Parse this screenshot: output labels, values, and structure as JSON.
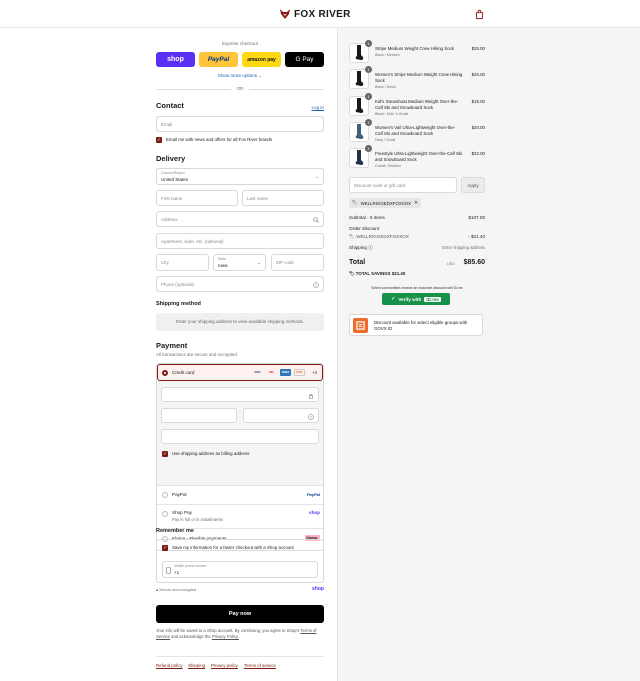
{
  "header": {
    "brand": "FOX RIVER"
  },
  "express": {
    "label": "Express checkout",
    "shop": "shop",
    "paypal": "PayPal",
    "amazon": "amazon pay",
    "gpay": "G Pay",
    "show_more": "Show more options ⌄",
    "or": "OR"
  },
  "contact": {
    "heading": "Contact",
    "login": "Log in",
    "email_placeholder": "Email",
    "news_label": "Email me with news and offers for all Fox River brands"
  },
  "delivery": {
    "heading": "Delivery",
    "country_label": "Country/Region",
    "country_value": "United States",
    "first_name": "First name",
    "last_name": "Last name",
    "address": "Address",
    "apartment": "Apartment, suite, etc. (optional)",
    "city": "City",
    "state_label": "State",
    "state_value": "Iowa",
    "zip": "ZIP code",
    "phone": "Phone (optional)"
  },
  "shipping_method": {
    "heading": "Shipping method",
    "message": "Enter your shipping address to view available shipping methods."
  },
  "payment": {
    "heading": "Payment",
    "subtitle": "All transactions are secure and encrypted.",
    "credit_card": "Credit card",
    "card_more": "+4",
    "card_logos": [
      "VISA",
      "MC",
      "AMEX",
      "DISC"
    ],
    "billing_label": "Use shipping address as billing address",
    "paypal": "PayPal",
    "paypal_logo": "PayPal",
    "shop_pay": "Shop Pay",
    "shop_pay_sub": "Pay in full or in installments",
    "shop_logo": "shop",
    "klarna": "Klarna - Flexible payments",
    "klarna_logo": "Klarna."
  },
  "remember": {
    "heading": "Remember me",
    "save_label": "Save my information for a faster checkout with a Shop account",
    "phone_label": "Mobile phone number",
    "phone_value": "+1",
    "secure": "Secure and encrypted",
    "shop": "shop"
  },
  "pay_now": "Pay now",
  "legal": {
    "text1": "Your info will be saved to a Shop account. By continuing, you agree to Shop's",
    "tos": "Terms of Service",
    "text2": "and acknowledge the",
    "privacy": "Privacy Policy."
  },
  "footer": {
    "links": [
      "Refund policy",
      "Shipping",
      "Privacy policy",
      "Terms of service"
    ]
  },
  "cart": {
    "items": [
      {
        "qty": "1",
        "name": "Stripe Medium Weight Crew Hiking Sock",
        "variant": "Black / Medium",
        "price": "$25.00"
      },
      {
        "qty": "1",
        "name": "Women's Stripe Medium Weight Crew Hiking Sock",
        "variant": "Black / Small",
        "price": "$25.00"
      },
      {
        "qty": "1",
        "name": "Kid's Steamboat Medium Weight Over-the-Calf Ski and Snowboard Sock",
        "variant": "Black / Kids' X-Small",
        "price": "$15.00"
      },
      {
        "qty": "1",
        "name": "Women's Vail Ultra-Lightweight Over-the-Calf Ski and Snowboard Sock",
        "variant": "Navy / Small",
        "price": "$20.00"
      },
      {
        "qty": "1",
        "name": "Freestyle Ultra-Lightweight Over-the-Calf Ski and Snowboard Sock",
        "variant": "Cobalt / Medium",
        "price": "$22.00"
      }
    ],
    "discount_placeholder": "Discount code or gift card",
    "apply": "Apply",
    "code_tag": "WELLRIGGEDXFOXSOX",
    "subtotal_label": "Subtotal · 5 items",
    "subtotal_value": "$107.00",
    "order_discount": "Order discount",
    "discount_code": "WELLRIGGEDXFOXSOX",
    "discount_value": "- $21.40",
    "shipping_label": "Shipping",
    "shipping_value": "Enter shipping address",
    "total_label": "Total",
    "currency": "USD",
    "total_value": "$85.60",
    "savings_label": "TOTAL SAVINGS",
    "savings_value": "$21.40",
    "verify_note": "Select communities receive an exclusive discount with ID.me",
    "verify_btn": "Verify with",
    "verify_brand": "ID.me",
    "govx_text": "Discount available for select eligible groups with GOVX ID"
  },
  "colors": {
    "accent": "#7a1b14",
    "shop": "#5a31f4",
    "paypal": "#ffc439",
    "amazon": "#ffd814",
    "idme": "#18914b",
    "govx": "#ee6d2e"
  }
}
